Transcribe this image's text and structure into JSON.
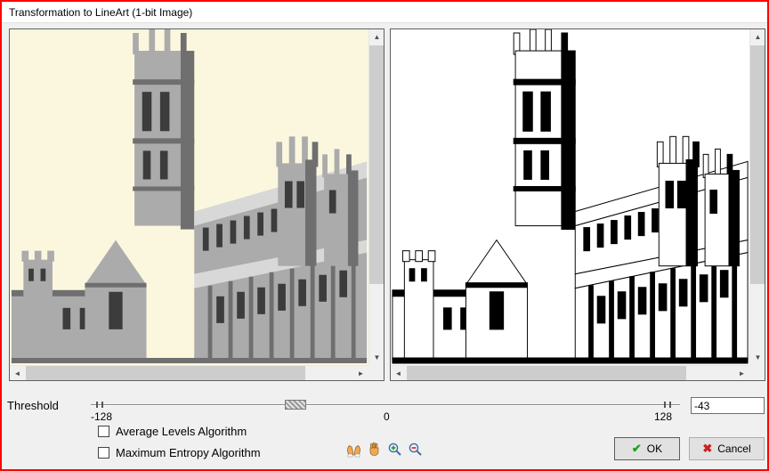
{
  "dialog": {
    "title": "Transformation to LineArt (1-bit Image)"
  },
  "threshold": {
    "label": "Threshold",
    "min_label": "-128",
    "mid_label": "0",
    "max_label": "128",
    "value": "-43"
  },
  "options": [
    {
      "label": "Average Levels Algorithm",
      "checked": false
    },
    {
      "label": "Maximum Entropy Algorithm",
      "checked": false
    }
  ],
  "buttons": {
    "ok": {
      "label": "OK",
      "glyph": "✔"
    },
    "cancel": {
      "label": "Cancel",
      "glyph": "✖"
    }
  },
  "icons": {
    "up": "▲",
    "down": "▼",
    "left": "◄",
    "right": "►"
  },
  "colors": {
    "dialog_border": "#fe0000",
    "dialog_bg": "#f0f0f0",
    "titlebar_bg": "#ffffff",
    "original_preview_bg": "#fbf7de",
    "lineart_preview_bg": "#ffffff",
    "ok_check": "#18a018",
    "cancel_cross": "#cc2020"
  }
}
